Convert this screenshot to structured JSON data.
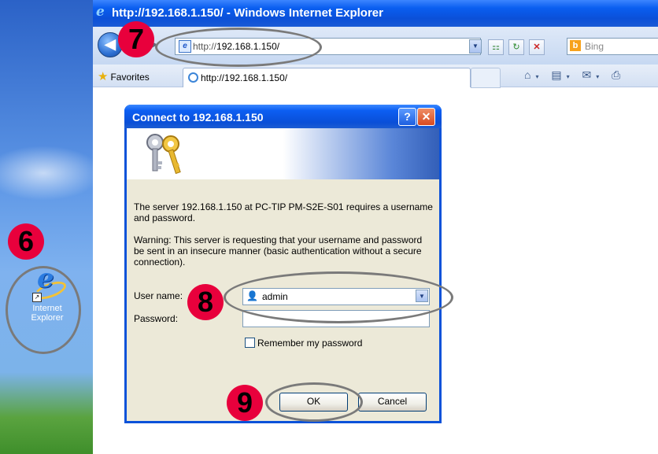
{
  "desktop": {
    "icon_label": "Internet Explorer"
  },
  "browser": {
    "title": "http://192.168.1.150/ - Windows Internet Explorer",
    "address_prefix": "http://",
    "address_host": "192.168.1.150/",
    "search_placeholder": "Bing",
    "favorites_label": "Favorites",
    "tab_label": "http://192.168.1.150/"
  },
  "dialog": {
    "title": "Connect to 192.168.1.150",
    "message": "The server 192.168.1.150 at PC-TIP PM-S2E-S01 requires a username and password.",
    "warning": "Warning: This server is requesting that your username and password be sent in an insecure manner (basic authentication without a secure connection).",
    "username_label": "User name:",
    "username_value": "admin",
    "password_label": "Password:",
    "password_value": "",
    "remember_label": "Remember my password",
    "ok_label": "OK",
    "cancel_label": "Cancel"
  },
  "annotations": {
    "step6": "6",
    "step7": "7",
    "step8": "8",
    "step9": "9"
  },
  "colors": {
    "badge": "#e8003c",
    "highlight_ring": "#7a7a7a",
    "xp_title_blue": "#0a4fd8"
  }
}
